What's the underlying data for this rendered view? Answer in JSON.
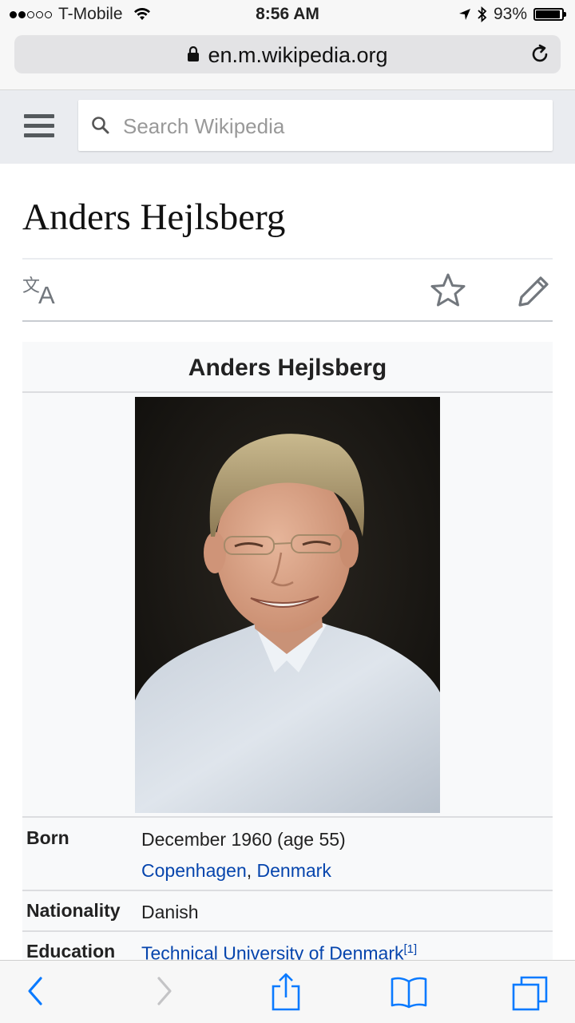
{
  "status_bar": {
    "carrier": "T-Mobile",
    "time": "8:56 AM",
    "battery": "93%",
    "battery_level": 0.93,
    "signal_bars_filled": 2,
    "signal_bars_total": 5
  },
  "browser": {
    "url": "en.m.wikipedia.org"
  },
  "wiki_header": {
    "search_placeholder": "Search Wikipedia"
  },
  "page": {
    "title": "Anders Hejlsberg"
  },
  "infobox": {
    "title": "Anders Hejlsberg",
    "rows": [
      {
        "label": "Born",
        "value": "December 1960 (age 55)",
        "place_city": "Copenhagen",
        "place_sep": ", ",
        "place_country": "Denmark"
      },
      {
        "label": "Nationality",
        "value": "Danish"
      },
      {
        "label": "Education",
        "value": "Technical University of Denmark",
        "ref": "[1]"
      }
    ]
  },
  "icons": {
    "lock": "lock-icon",
    "reload": "reload-icon",
    "menu": "hamburger-menu-icon",
    "search": "search-icon",
    "language": "language-icon",
    "watch": "star-icon",
    "edit": "pencil-icon",
    "back": "chevron-left-icon",
    "forward": "chevron-right-icon",
    "share": "share-icon",
    "bookmarks": "book-icon",
    "tabs": "tabs-icon"
  },
  "colors": {
    "link": "#0645ad",
    "ios_blue": "#0a7aff",
    "wiki_header_bg": "#eaecf0",
    "infobox_bg": "#f8f9fa"
  }
}
